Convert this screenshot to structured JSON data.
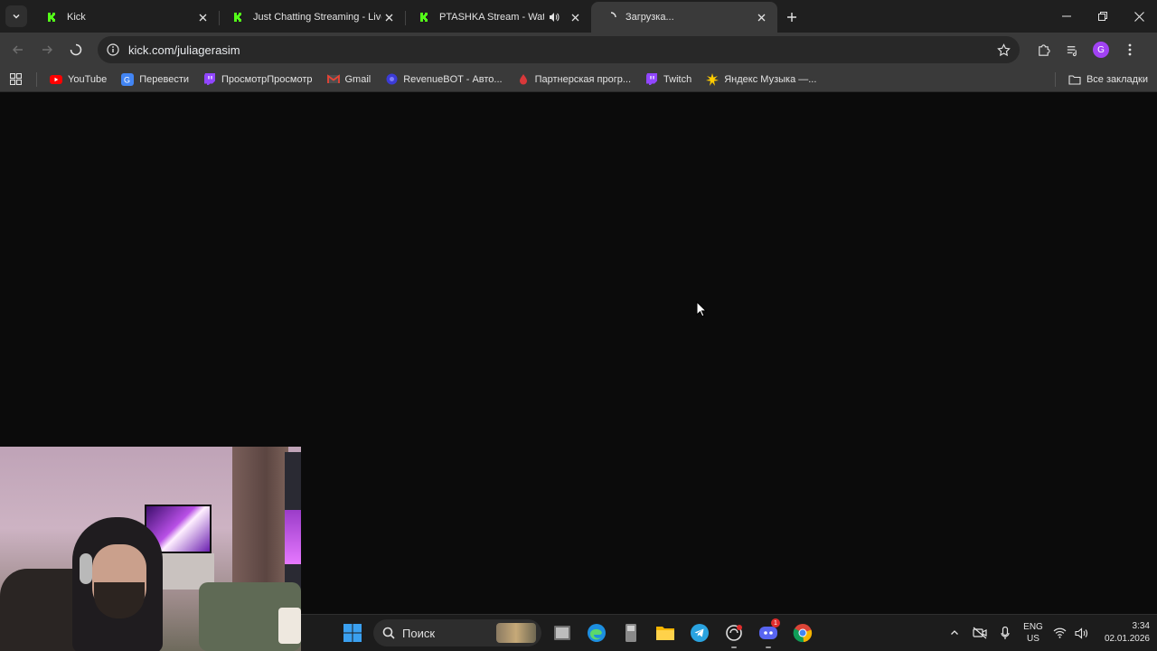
{
  "browser": {
    "tabs": [
      {
        "title": "Kick",
        "favicon": "kick-icon",
        "active": false
      },
      {
        "title": "Just Chatting Streaming - Live S",
        "favicon": "kick-icon",
        "active": false
      },
      {
        "title": "PTASHKA Stream - Watch Li",
        "favicon": "kick-icon",
        "active": false,
        "audio": true
      },
      {
        "title": "Загрузка...",
        "favicon": "loading-spinner-icon",
        "active": true
      }
    ],
    "url": "kick.com/juliagerasim",
    "profile_initial": "G"
  },
  "bookmarks": {
    "items": [
      {
        "label": "YouTube",
        "icon": "youtube-icon",
        "color": "#ff0000"
      },
      {
        "label": "Перевести",
        "icon": "translate-icon",
        "color": "#4285f4"
      },
      {
        "label": "ПросмотрПросмотр",
        "icon": "twitch-icon",
        "color": "#9146ff"
      },
      {
        "label": "Gmail",
        "icon": "gmail-icon",
        "color": "#ea4335"
      },
      {
        "label": "RevenueBOT - Авто...",
        "icon": "revenuebot-icon",
        "color": "#3b3bd6"
      },
      {
        "label": "Партнерская прогр...",
        "icon": "partner-icon",
        "color": "#d9383a"
      },
      {
        "label": "Twitch",
        "icon": "twitch-icon",
        "color": "#9146ff"
      },
      {
        "label": "Яндекс Музыка —...",
        "icon": "yandex-music-icon",
        "color": "#ffcc00"
      }
    ],
    "all_label": "Все закладки"
  },
  "taskbar": {
    "search_placeholder": "Поиск",
    "apps": [
      "windows-start-icon",
      "task-view-icon",
      "edge-icon",
      "file-manager-icon",
      "explorer-folder-icon",
      "telegram-icon",
      "app-icon",
      "discord-icon",
      "chrome-icon"
    ],
    "discord_badge": "1",
    "lang_top": "ENG",
    "lang_bottom": "US",
    "time": "3:34",
    "date": "02.01.2026"
  }
}
